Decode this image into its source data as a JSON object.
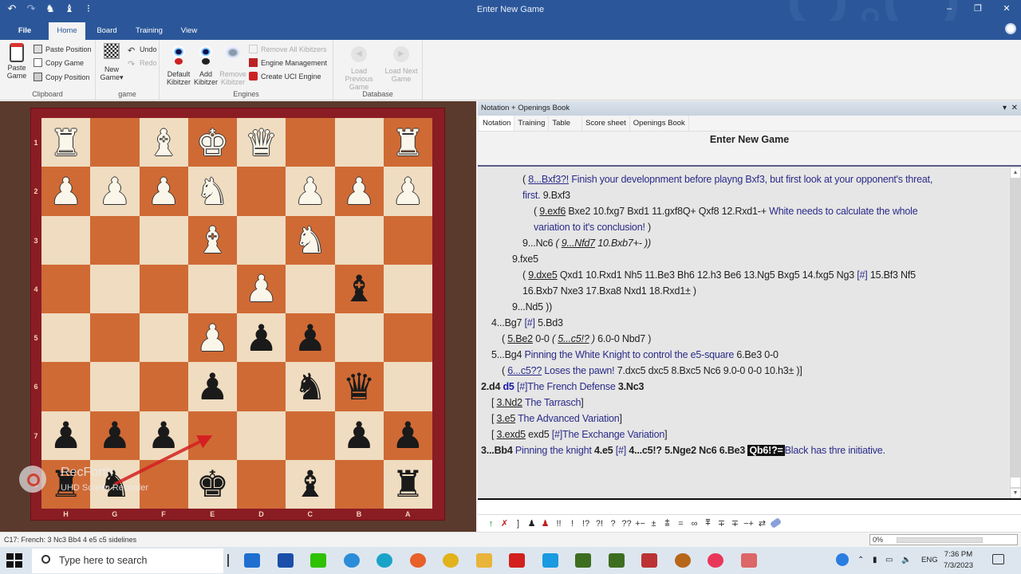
{
  "window": {
    "title": "Enter New Game",
    "quick_access": [
      "undo-icon",
      "redo-icon",
      "fritz-icon",
      "engine-icon",
      "customize-icon"
    ],
    "controls": {
      "minimize": "‒",
      "restore": "❐",
      "close": "✕"
    }
  },
  "ribbon": {
    "tabs": [
      {
        "label": "File",
        "active": false
      },
      {
        "label": "Home",
        "active": true
      },
      {
        "label": "Board",
        "active": false
      },
      {
        "label": "Training",
        "active": false
      },
      {
        "label": "View",
        "active": false
      }
    ],
    "groups": {
      "clipboard": {
        "label": "Clipboard",
        "paste_game": "Paste Game",
        "paste_position": "Paste Position",
        "copy_game": "Copy Game",
        "copy_position": "Copy Position"
      },
      "game": {
        "label": "game",
        "new_game": "New Game▾",
        "undo": "Undo",
        "redo": "Redo"
      },
      "engines": {
        "label": "Engines",
        "default_kibitzer": "Default Kibitzer",
        "add_kibitzer": "Add Kibitzer",
        "remove_kibitzer": "Remove Kibitzer",
        "remove_all_kibitzers": "Remove All Kibitzers",
        "engine_management": "Engine Management",
        "create_uci_engine": "Create UCI Engine"
      },
      "database": {
        "label": "Database",
        "load_previous": "Load Previous Game",
        "load_next": "Load Next Game"
      }
    }
  },
  "board": {
    "orientation": "black",
    "rank_labels": [
      "1",
      "2",
      "3",
      "4",
      "5",
      "6",
      "7",
      "8"
    ],
    "file_labels": [
      "H",
      "G",
      "F",
      "E",
      "D",
      "C",
      "B",
      "A"
    ],
    "rows": [
      [
        "wR",
        "",
        "wB",
        "wK",
        "wQ",
        "",
        "",
        "wR"
      ],
      [
        "wP",
        "wP",
        "wP",
        "wN",
        "",
        "wP",
        "wP",
        "wP"
      ],
      [
        "",
        "",
        "",
        "wB",
        "",
        "wN",
        "",
        ""
      ],
      [
        "",
        "",
        "",
        "",
        "wP",
        "",
        "bB",
        ""
      ],
      [
        "",
        "",
        "",
        "wP",
        "bP",
        "bP",
        "",
        ""
      ],
      [
        "",
        "",
        "",
        "bP",
        "",
        "bN",
        "bQ",
        ""
      ],
      [
        "bP",
        "bP",
        "bP",
        "",
        "",
        "",
        "bP",
        "bP"
      ],
      [
        "bR",
        "bN",
        "",
        "bK",
        "",
        "bB",
        "",
        "bR"
      ]
    ],
    "arrow": {
      "from": "g8",
      "to": "e7",
      "color": "#d42020"
    },
    "watermark": {
      "title": "RecForth",
      "subtitle": "UHD Screen Recorder"
    }
  },
  "notation": {
    "pane_title": "Notation + Openings Book",
    "tabs": [
      {
        "label": "Notation",
        "active": true
      },
      {
        "label": "Training",
        "active": false
      },
      {
        "label": "Table",
        "active": false
      },
      {
        "label": "Score sheet",
        "active": false
      },
      {
        "label": "Openings Book",
        "active": false
      }
    ],
    "game_title": "Enter New Game",
    "lines": [
      [
        {
          "t": "( "
        },
        {
          "t": "8...Bxf3?!",
          "c": "u cm"
        },
        {
          "t": " Finish your developnment before playng Bxf3, but first look at your opponent's threat,",
          "c": "cm"
        }
      ],
      [
        {
          "t": "first.",
          "c": "cm"
        },
        {
          "t": "  9.Bxf3"
        }
      ],
      [
        {
          "t": "( "
        },
        {
          "t": "9.exf6",
          "c": "u"
        },
        {
          "t": "  Bxe2  10.fxg7  Bxd1  11.gxf8Q+  Qxf8  12.Rxd1-+ "
        },
        {
          "t": "White needs to calculate the whole",
          "c": "cm"
        }
      ],
      [
        {
          "t": "variation to it's conclusion!",
          "c": "cm"
        },
        {
          "t": " )"
        }
      ],
      [
        {
          "t": "9...Nc6  "
        },
        {
          "t": "( ",
          "c": "i"
        },
        {
          "t": "9...Nfd7",
          "c": "i u"
        },
        {
          "t": "  10.Bxb7+-  ))",
          "c": "i"
        }
      ],
      [
        {
          "t": "9.fxe5"
        }
      ],
      [
        {
          "t": "( "
        },
        {
          "t": "9.dxe5",
          "c": "u"
        },
        {
          "t": "  Qxd1  10.Rxd1  Nh5  11.Be3  Bh6  12.h3  Be6  13.Ng5  Bxg5  14.fxg5  Ng3 "
        },
        {
          "t": "[#]",
          "c": "cm"
        },
        {
          "t": "  15.Bf3  Nf5"
        }
      ],
      [
        {
          "t": "16.Bxb7  Nxe3  17.Bxa8  Nxd1  18.Rxd1± )"
        }
      ],
      [
        {
          "t": "9...Nd5 ))"
        }
      ],
      [
        {
          "t": "4...Bg7 "
        },
        {
          "t": "[#]",
          "c": "cm"
        },
        {
          "t": "  5.Bd3"
        }
      ],
      [
        {
          "t": "( "
        },
        {
          "t": "5.Be2",
          "c": "u"
        },
        {
          "t": "  0-0  "
        },
        {
          "t": "( ",
          "c": "i"
        },
        {
          "t": "5...c5!?",
          "c": "i u"
        },
        {
          "t": " )",
          "c": "i"
        },
        {
          "t": " 6.0-0  Nbd7 )"
        }
      ],
      [
        {
          "t": "5...Bg4 "
        },
        {
          "t": "Pinning the White Knight to control the e5-square",
          "c": "cm"
        },
        {
          "t": "  6.Be3  0-0"
        }
      ],
      [
        {
          "t": "( "
        },
        {
          "t": "6...c5??",
          "c": "u cm"
        },
        {
          "t": " Loses the pawn!",
          "c": "cm"
        },
        {
          "t": "  7.dxc5  dxc5  8.Bxc5  Nc6  9.0-0  0-0  10.h3± )]"
        }
      ],
      [
        {
          "t": "2.d4",
          "c": "b"
        },
        {
          "t": "  "
        },
        {
          "t": "d5",
          "c": "blue"
        },
        {
          "t": " [#]",
          "c": "cm"
        },
        {
          "t": "The French Defense",
          "c": "cm"
        },
        {
          "t": "  "
        },
        {
          "t": "3.Nc3",
          "c": "b"
        }
      ],
      [
        {
          "t": "[ "
        },
        {
          "t": "3.Nd2",
          "c": "u"
        },
        {
          "t": " The Tarrasch",
          "c": "cm"
        },
        {
          "t": "]"
        }
      ],
      [
        {
          "t": "[ "
        },
        {
          "t": "3.e5",
          "c": "u"
        },
        {
          "t": " The Advanced Variation",
          "c": "cm"
        },
        {
          "t": "]"
        }
      ],
      [
        {
          "t": "[ "
        },
        {
          "t": "3.exd5",
          "c": "u"
        },
        {
          "t": "  exd5 "
        },
        {
          "t": "[#]The Exchange Variation",
          "c": "cm"
        },
        {
          "t": "]"
        }
      ],
      [
        {
          "t": "3...Bb4",
          "c": "b"
        },
        {
          "t": " Pinning the knight",
          "c": "cm"
        },
        {
          "t": "  "
        },
        {
          "t": "4.e5",
          "c": "b"
        },
        {
          "t": " [#]",
          "c": "cm"
        },
        {
          "t": "  "
        },
        {
          "t": "4...c5!?",
          "c": "b"
        },
        {
          "t": "  "
        },
        {
          "t": "5.Nge2",
          "c": "b"
        },
        {
          "t": "  "
        },
        {
          "t": "Nc6",
          "c": "b"
        },
        {
          "t": "  "
        },
        {
          "t": "6.Be3",
          "c": "b"
        },
        {
          "t": "  "
        },
        {
          "t": "Qb6!?=",
          "c": "hl"
        },
        {
          "t": "Black has thre initiative.",
          "c": "cm"
        }
      ]
    ],
    "symbols": [
      "↑",
      "✗",
      "]",
      "♟",
      "♟",
      "!!",
      "!",
      "!?",
      "?!",
      "?",
      "??",
      "+−",
      "±",
      "⩲",
      "=",
      "∞",
      "⩱",
      "∓",
      "∓",
      "−+",
      "⇄",
      "eraser-icon"
    ]
  },
  "status": {
    "eco": "C17: French: 3 Nc3 Bb4 4 e5 c5 sidelines",
    "progress_label": "0%",
    "progress_fraction": 0
  },
  "taskbar": {
    "search_placeholder": "Type here to search",
    "apps": [
      "mail",
      "store",
      "wechat",
      "app-blue",
      "edge",
      "firefox",
      "chrome",
      "file-explorer",
      "acrobat",
      "skype",
      "fritz-reader-1",
      "fritz-reader-2",
      "chessbase",
      "app-orange",
      "recforth",
      "snipping"
    ],
    "tray": {
      "lang": "ENG",
      "time": "7:36 PM",
      "date": "7/3/2023"
    }
  }
}
